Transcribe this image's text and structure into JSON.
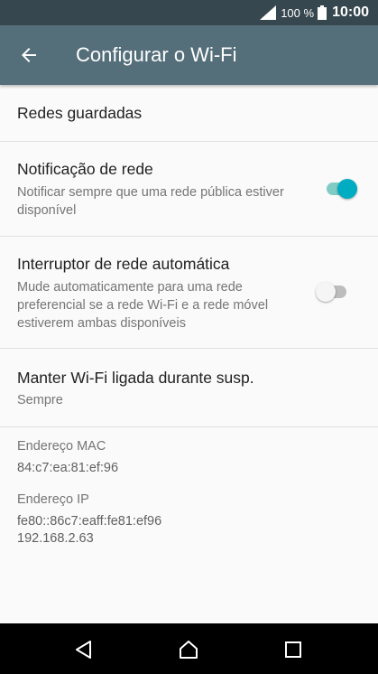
{
  "status_bar": {
    "battery_percent": "100 %",
    "time": "10:00"
  },
  "app_bar": {
    "title": "Configurar o Wi-Fi"
  },
  "settings": {
    "saved_networks": {
      "title": "Redes guardadas"
    },
    "network_notification": {
      "title": "Notificação de rede",
      "subtitle": "Notificar sempre que uma rede pública estiver disponível",
      "enabled": true
    },
    "auto_network_switch": {
      "title": "Interruptor de rede automática",
      "subtitle": "Mude automaticamente para uma rede preferencial se a rede Wi-Fi e a rede móvel estiverem ambas disponíveis",
      "enabled": false
    },
    "keep_wifi_on": {
      "title": "Manter Wi-Fi ligada durante susp.",
      "value": "Sempre"
    }
  },
  "info": {
    "mac_label": "Endereço MAC",
    "mac_value": "84:c7:ea:81:ef:96",
    "ip_label": "Endereço IP",
    "ip_value_1": "fe80::86c7:eaff:fe81:ef96",
    "ip_value_2": "192.168.2.63"
  },
  "nav_bar": {
    "icons": [
      "back-icon",
      "home-icon",
      "recents-icon"
    ]
  }
}
